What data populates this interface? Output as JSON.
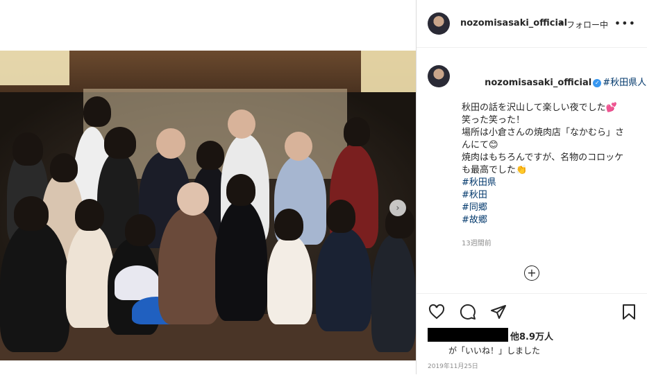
{
  "post": {
    "photo_alt": "group photo",
    "next_arrow": "›"
  },
  "header": {
    "username": "nozomisasaki_official",
    "separator": "•",
    "follow_status": "フォロー中",
    "more": "•••"
  },
  "caption": {
    "username": "nozomisasaki_official",
    "verified_mark": "✓",
    "first_tag": "#秋田県人会",
    "lines": [
      "秋田の話を沢山して楽しい夜でした💕",
      "笑った笑った！",
      "",
      "場所は小倉さんの焼肉店「なかむら」さ",
      "んにて😊",
      "焼肉はもちろんですが、名物のコロッケ",
      "も最高でした👏",
      ""
    ],
    "hashtags": [
      "#秋田県",
      "#秋田",
      "#同郷",
      "#故郷"
    ]
  },
  "time_ago": "13週間前",
  "add_comment_icon": "+",
  "actions": {
    "like_icon": "heart-icon",
    "comment_icon": "comment-icon",
    "share_icon": "share-icon",
    "save_icon": "bookmark-icon"
  },
  "likes": {
    "count_text": "他8.9万人",
    "suffix": "が「いいね！」しました"
  },
  "date": "2019年11月25日",
  "colors": {
    "link": "#00376b",
    "verified": "#3897f0",
    "muted": "#8e8e8e"
  }
}
